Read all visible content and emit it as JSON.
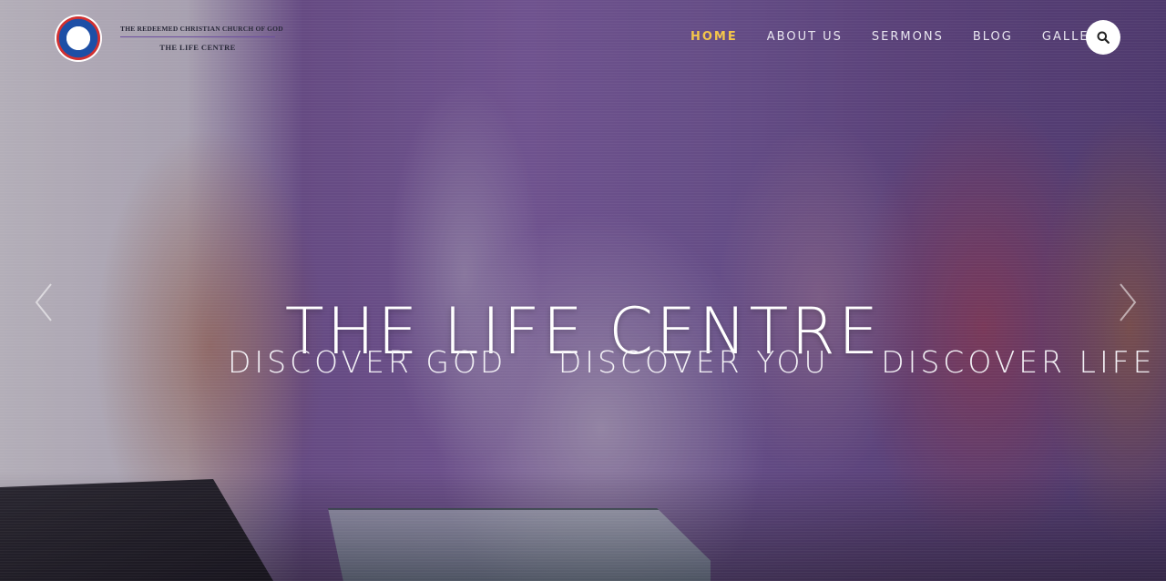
{
  "header": {
    "org_name": "THE REDEEMED CHRISTIAN CHURCH OF GOD",
    "org_sub": "THE LIFE CENTRE",
    "logo_icon": "rccg-seal-logo"
  },
  "nav": {
    "items": [
      {
        "label": "HOME",
        "active": true
      },
      {
        "label": "ABOUT US",
        "active": false
      },
      {
        "label": "SERMONS",
        "active": false
      },
      {
        "label": "BLOG",
        "active": false
      },
      {
        "label": "GALLERY",
        "active": false
      }
    ],
    "search_icon": "search-icon",
    "active_color": "#f4c64a"
  },
  "hero": {
    "title": "THE LIFE CENTRE",
    "taglines": [
      "DISCOVER GOD",
      "DISCOVER YOU",
      "DISCOVER LIFE"
    ],
    "prev_icon": "chevron-left-icon",
    "next_icon": "chevron-right-icon"
  }
}
